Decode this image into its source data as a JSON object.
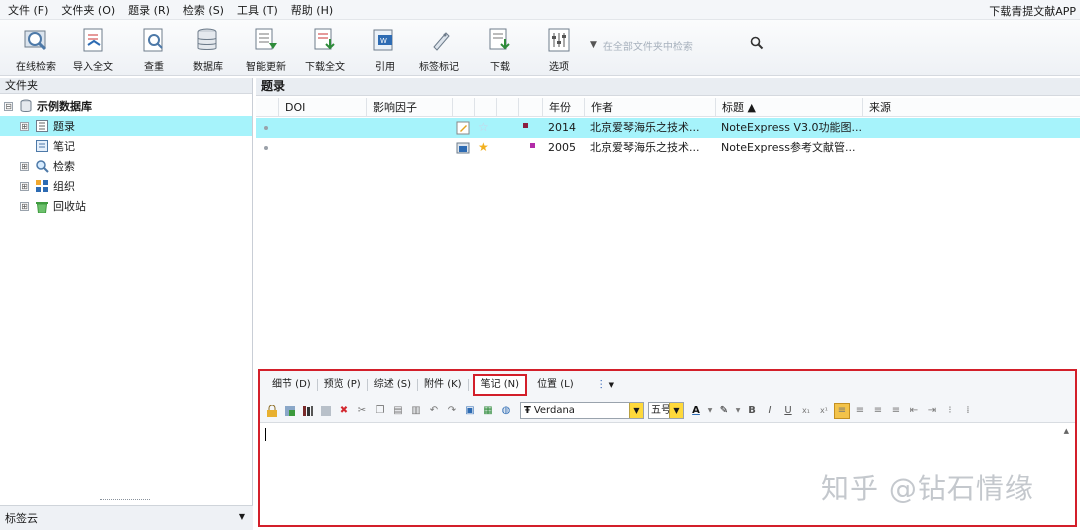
{
  "menu": {
    "items": [
      "文件 (F)",
      "文件夹 (O)",
      "题录 (R)",
      "检索 (S)",
      "工具 (T)",
      "帮助 (H)"
    ],
    "app_link": "下载青提文献APP"
  },
  "toolbar": {
    "buttons": [
      "在线检索",
      "导入全文",
      "查重",
      "数据库",
      "智能更新",
      "下载全文",
      "引用",
      "标签标记",
      "下载",
      "选项"
    ],
    "search_placeholder": "在全部文件夹中检索"
  },
  "left": {
    "header": "文件夹",
    "tree": [
      {
        "label": "示例数据库",
        "expander": "⊟"
      },
      {
        "label": "题录",
        "expander": "⊞"
      },
      {
        "label": "笔记",
        "expander": ""
      },
      {
        "label": "检索",
        "expander": "⊞"
      },
      {
        "label": "组织",
        "expander": "⊞"
      },
      {
        "label": "回收站",
        "expander": "⊞"
      }
    ],
    "tag_cloud": "标签云"
  },
  "right": {
    "header": "题录",
    "columns": [
      "DOI",
      "影响因子",
      "年份",
      "作者",
      "标题 ▲",
      "来源"
    ],
    "rows": [
      {
        "year": "2014",
        "author": "北京爱琴海乐之技术...",
        "title": "NoteExpress V3.0功能图...",
        "source": ""
      },
      {
        "year": "2005",
        "author": "北京爱琴海乐之技术...",
        "title": "NoteExpress参考文献管...",
        "source": ""
      }
    ]
  },
  "notes": {
    "tabs": [
      "细节 (D)",
      "预览 (P)",
      "综述 (S)",
      "附件 (K)",
      "笔记 (N)",
      "位置 (L)"
    ],
    "font": "Verdana",
    "size": "五号",
    "watermark": "知乎 @钻石情缘"
  },
  "colors": {
    "selection": "#a6f3fb",
    "highlight_border": "#d31f2a"
  }
}
